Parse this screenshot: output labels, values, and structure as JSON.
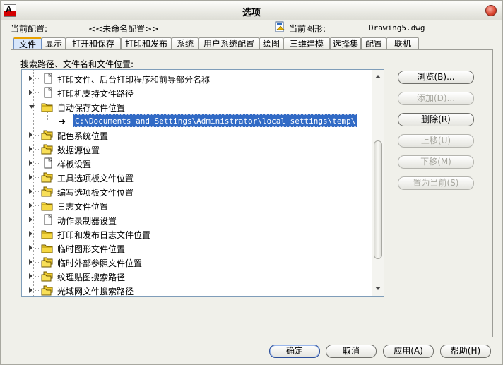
{
  "window": {
    "title": "选项"
  },
  "header": {
    "profile_label": "当前配置:",
    "profile_value": "<<未命名配置>>",
    "drawing_label": "当前图形:",
    "drawing_value": "Drawing5.dwg"
  },
  "tabs": [
    {
      "label": "文件",
      "active": true
    },
    {
      "label": "显示"
    },
    {
      "label": "打开和保存"
    },
    {
      "label": "打印和发布"
    },
    {
      "label": "系统"
    },
    {
      "label": "用户系统配置"
    },
    {
      "label": "绘图"
    },
    {
      "label": "三维建模"
    },
    {
      "label": "选择集"
    },
    {
      "label": "配置"
    },
    {
      "label": "联机"
    }
  ],
  "section_label": "搜索路径、文件名和文件位置:",
  "tree": {
    "items": [
      {
        "label": "打印文件、后台打印程序和前导部分名称",
        "icon": "file-icon"
      },
      {
        "label": "打印机支持文件路径",
        "icon": "file-icon"
      },
      {
        "label": "自动保存文件位置",
        "icon": "folder-icon",
        "expanded": true
      },
      {
        "label": "配色系统位置",
        "icon": "folders-icon"
      },
      {
        "label": "数据源位置",
        "icon": "folders-icon"
      },
      {
        "label": "样板设置",
        "icon": "file-icon"
      },
      {
        "label": "工具选项板文件位置",
        "icon": "folders-icon"
      },
      {
        "label": "编写选项板文件位置",
        "icon": "folders-icon"
      },
      {
        "label": "日志文件位置",
        "icon": "folder-icon"
      },
      {
        "label": "动作录制器设置",
        "icon": "file-icon"
      },
      {
        "label": "打印和发布日志文件位置",
        "icon": "folder-icon"
      },
      {
        "label": "临时图形文件位置",
        "icon": "folder-icon"
      },
      {
        "label": "临时外部参照文件位置",
        "icon": "folders-icon"
      },
      {
        "label": "纹理贴图搜索路径",
        "icon": "folders-icon"
      },
      {
        "label": "光域网文件搜索路径",
        "icon": "folders-icon"
      }
    ],
    "selected_child": "C:\\Documents and Settings\\Administrator\\local settings\\temp\\"
  },
  "side_buttons": {
    "browse": "浏览(B)...",
    "add": "添加(D)...",
    "remove": "删除(R)",
    "move_up": "上移(U)",
    "move_down": "下移(M)",
    "set_current": "置为当前(S)"
  },
  "bottom_buttons": {
    "ok": "确定",
    "cancel": "取消",
    "apply": "应用(A)",
    "help": "帮助(H)"
  },
  "colors": {
    "selection": "#316ac5",
    "tab_active": "#d7e6fa",
    "close_button": "#d9442f"
  }
}
